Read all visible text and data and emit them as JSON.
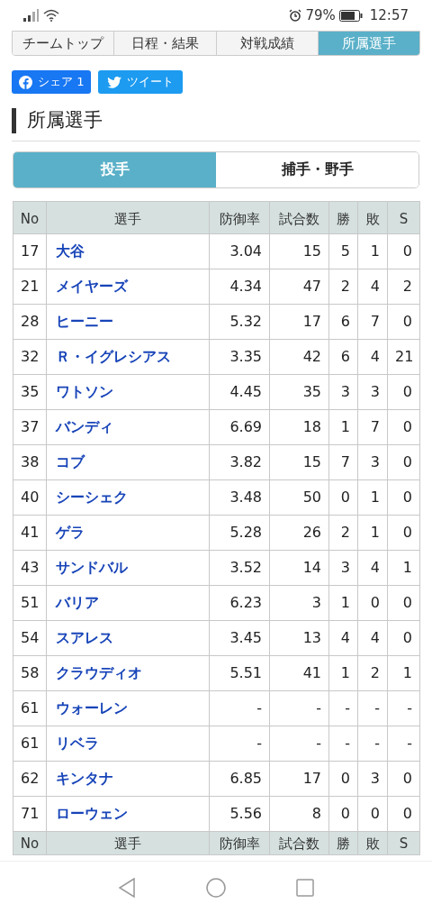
{
  "status_bar": {
    "battery_text": "79%",
    "time": "12:57"
  },
  "nav_tabs": [
    {
      "label": "チームトップ",
      "selected": false
    },
    {
      "label": "日程・結果",
      "selected": false
    },
    {
      "label": "対戦成績",
      "selected": false
    },
    {
      "label": "所属選手",
      "selected": true
    }
  ],
  "share_buttons": [
    {
      "kind": "facebook",
      "label": "シェア 1"
    },
    {
      "kind": "twitter",
      "label": "ツイート"
    }
  ],
  "heading": "所属選手",
  "position_tabs": [
    {
      "label": "投手",
      "selected": true
    },
    {
      "label": "捕手・野手",
      "selected": false
    }
  ],
  "table": {
    "columns": [
      "No",
      "選手",
      "防御率",
      "試合数",
      "勝",
      "敗",
      "S"
    ],
    "rows": [
      [
        "17",
        "大谷",
        "3.04",
        "15",
        "5",
        "1",
        "0"
      ],
      [
        "21",
        "メイヤーズ",
        "4.34",
        "47",
        "2",
        "4",
        "2"
      ],
      [
        "28",
        "ヒーニー",
        "5.32",
        "17",
        "6",
        "7",
        "0"
      ],
      [
        "32",
        "Ｒ・イグレシアス",
        "3.35",
        "42",
        "6",
        "4",
        "21"
      ],
      [
        "35",
        "ワトソン",
        "4.45",
        "35",
        "3",
        "3",
        "0"
      ],
      [
        "37",
        "バンディ",
        "6.69",
        "18",
        "1",
        "7",
        "0"
      ],
      [
        "38",
        "コブ",
        "3.82",
        "15",
        "7",
        "3",
        "0"
      ],
      [
        "40",
        "シーシェク",
        "3.48",
        "50",
        "0",
        "1",
        "0"
      ],
      [
        "41",
        "ゲラ",
        "5.28",
        "26",
        "2",
        "1",
        "0"
      ],
      [
        "43",
        "サンドバル",
        "3.52",
        "14",
        "3",
        "4",
        "1"
      ],
      [
        "51",
        "バリア",
        "6.23",
        "3",
        "1",
        "0",
        "0"
      ],
      [
        "54",
        "スアレス",
        "3.45",
        "13",
        "4",
        "4",
        "0"
      ],
      [
        "58",
        "クラウディオ",
        "5.51",
        "41",
        "1",
        "2",
        "1"
      ],
      [
        "61",
        "ウォーレン",
        "-",
        "-",
        "-",
        "-",
        "-"
      ],
      [
        "61",
        "リベラ",
        "-",
        "-",
        "-",
        "-",
        "-"
      ],
      [
        "62",
        "キンタナ",
        "6.85",
        "17",
        "0",
        "3",
        "0"
      ],
      [
        "71",
        "ローウェン",
        "5.56",
        "8",
        "0",
        "0",
        "0"
      ]
    ],
    "footer_columns": [
      "No",
      "選手",
      "防御率",
      "試合数",
      "勝",
      "敗",
      "S"
    ]
  }
}
